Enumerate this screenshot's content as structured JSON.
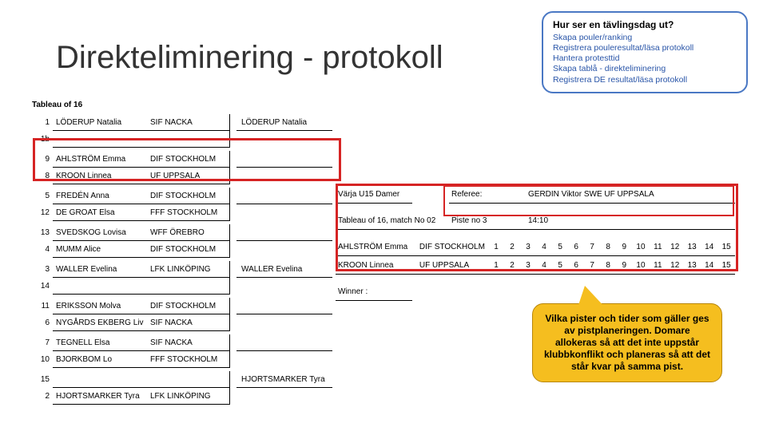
{
  "title": "Direkteliminering - protokoll",
  "info": {
    "heading": "Hur ser en tävlingsdag ut?",
    "l1": "Skapa pouler/ranking",
    "l2": "Registrera pouleresultat/läsa protokoll",
    "l3": "Hantera protesttid",
    "l4": "Skapa tablå - direkteliminering",
    "l5": "Registrera DE resultat/läsa protokoll"
  },
  "bracket": {
    "header": "Tableau of 16",
    "rows": [
      {
        "n": "1",
        "name": "LÖDERUP Natalia",
        "club": "SIF NACKA",
        "winner": "LÖDERUP Natalia"
      },
      {
        "n": "1b",
        "name": "",
        "club": ""
      },
      {
        "n": "9",
        "name": "AHLSTRÖM Emma",
        "club": "DIF STOCKHOLM"
      },
      {
        "n": "8",
        "name": "KROON Linnea",
        "club": "UF UPPSALA"
      },
      {
        "n": "5",
        "name": "FREDÉN Anna",
        "club": "DIF STOCKHOLM"
      },
      {
        "n": "12",
        "name": "DE GROAT Elsa",
        "club": "FFF STOCKHOLM"
      },
      {
        "n": "13",
        "name": "SVEDSKOG Lovisa",
        "club": "WFF ÖREBRO"
      },
      {
        "n": "4",
        "name": "MUMM Alice",
        "club": "DIF STOCKHOLM"
      },
      {
        "n": "3",
        "name": "WALLER Evelina",
        "club": "LFK LINKÖPING",
        "winner": "WALLER Evelina"
      },
      {
        "n": "14",
        "name": "",
        "club": ""
      },
      {
        "n": "11",
        "name": "ERIKSSON Molva",
        "club": "DIF STOCKHOLM"
      },
      {
        "n": "6",
        "name": "NYGÅRDS EKBERG Liv",
        "club": "SIF NACKA"
      },
      {
        "n": "7",
        "name": "TEGNELL Elsa",
        "club": "SIF NACKA"
      },
      {
        "n": "10",
        "name": "BJORKBOM Lo",
        "club": "FFF STOCKHOLM"
      },
      {
        "n": "15",
        "name": "",
        "club": ""
      },
      {
        "n": "2",
        "name": "HJORTSMARKER Tyra",
        "club": "LFK LINKÖPING",
        "winner": "HJORTSMARKER Tyra"
      }
    ]
  },
  "detail": {
    "event": "Värja U15 Damer",
    "refLabel": "Referee:",
    "referee": "GERDIN Viktor SWE UF UPPSALA",
    "tabLabel": "Tableau of 16, match No 02",
    "pisteLabel": "Piste no 3",
    "time": "14:10",
    "f1": {
      "name": "AHLSTRÖM Emma",
      "club": "DIF STOCKHOLM"
    },
    "f2": {
      "name": "KROON Linnea",
      "club": "UF UPPSALA"
    },
    "winner": "Winner :",
    "nums": [
      "1",
      "2",
      "3",
      "4",
      "5",
      "6",
      "7",
      "8",
      "9",
      "10",
      "11",
      "12",
      "13",
      "14",
      "15"
    ]
  },
  "callout": "Vilka pister och tider som gäller ges av pistplaneringen. Domare allokeras så att det inte uppstår klubbkonflikt och planeras så att det står kvar på samma pist."
}
